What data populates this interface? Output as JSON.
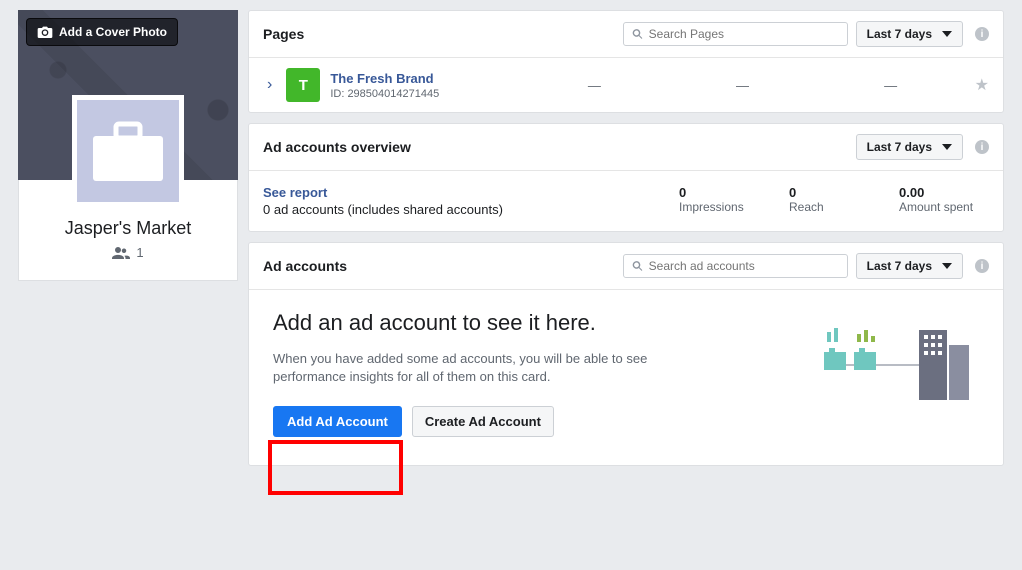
{
  "sidebar": {
    "cover_button": "Add a Cover Photo",
    "org_name": "Jasper's Market",
    "member_count": "1"
  },
  "pages": {
    "title": "Pages",
    "search_placeholder": "Search Pages",
    "range": "Last 7 days",
    "row": {
      "initial": "T",
      "name": "The Fresh Brand",
      "id_label": "ID: 298504014271445",
      "m1": "—",
      "m2": "—",
      "m3": "—"
    }
  },
  "overview": {
    "title": "Ad accounts overview",
    "range": "Last 7 days",
    "see_report": "See report",
    "sub": "0 ad accounts (includes shared accounts)",
    "metrics": [
      {
        "v": "0",
        "l": "Impressions"
      },
      {
        "v": "0",
        "l": "Reach"
      },
      {
        "v": "0.00",
        "l": "Amount spent"
      }
    ]
  },
  "accounts": {
    "title": "Ad accounts",
    "search_placeholder": "Search ad accounts",
    "range": "Last 7 days",
    "empty_title": "Add an ad account to see it here.",
    "empty_desc": "When you have added some ad accounts, you will be able to see performance insights for all of them on this card.",
    "add_btn": "Add Ad Account",
    "create_btn": "Create Ad Account"
  }
}
